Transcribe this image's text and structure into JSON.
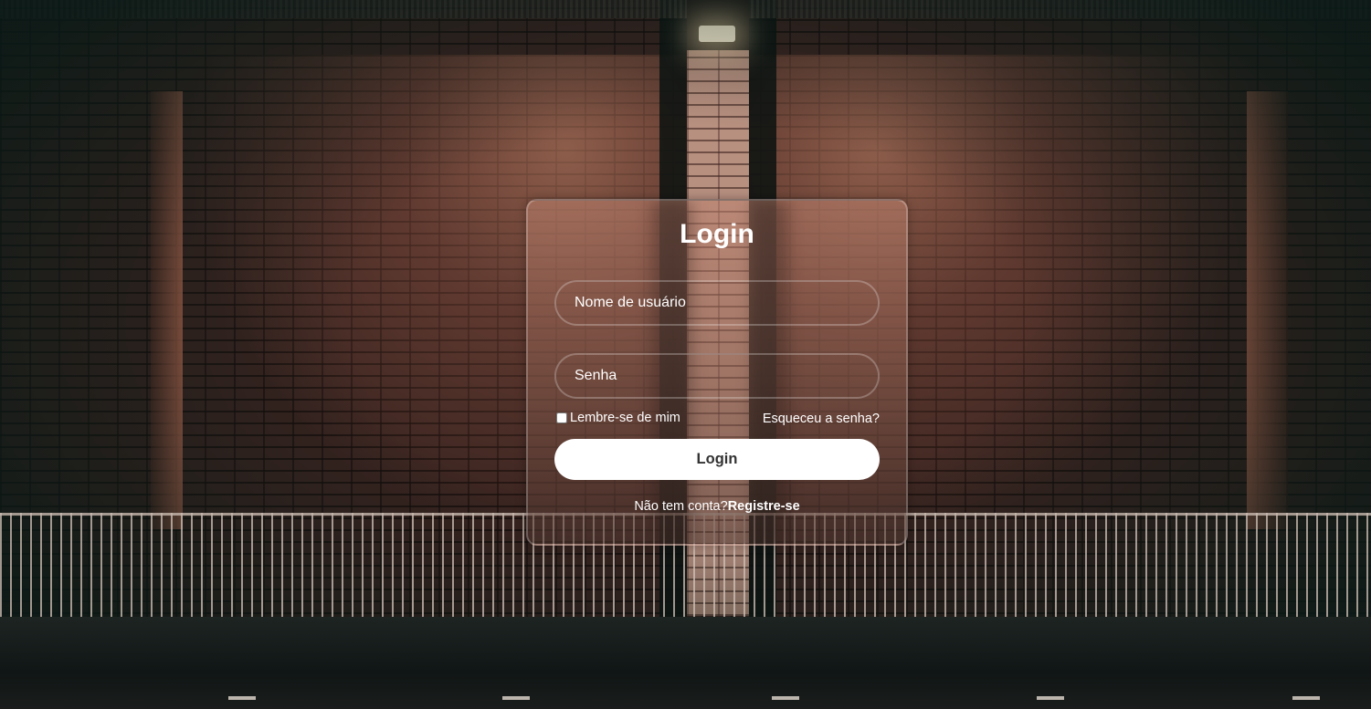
{
  "login_form": {
    "title": "Login",
    "username_placeholder": "Nome de usuário",
    "password_placeholder": "Senha",
    "remember_label": "Lembre-se de mim",
    "remember_checked": false,
    "forgot_link": "Esqueceu a senha?",
    "submit_label": "Login",
    "register_prompt": "Não tem conta?",
    "register_link": "Registre-se"
  },
  "theme": {
    "card_border": "#ffffff",
    "button_background": "#ffffff",
    "button_text": "#333333",
    "text_color": "#ffffff"
  }
}
